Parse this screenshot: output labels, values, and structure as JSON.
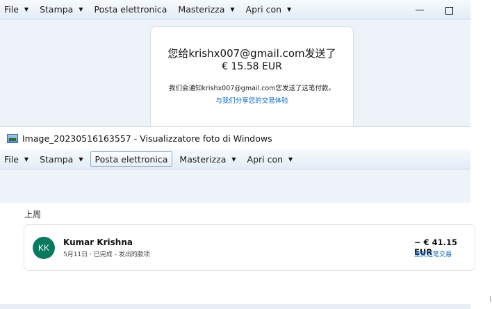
{
  "top_menu": {
    "items": [
      {
        "label": "File",
        "has_arrow": true
      },
      {
        "label": "Stampa",
        "has_arrow": true
      },
      {
        "label": "Posta elettronica",
        "has_arrow": false
      },
      {
        "label": "Masterizza",
        "has_arrow": true
      },
      {
        "label": "Apri con",
        "has_arrow": true
      }
    ]
  },
  "receipt": {
    "title": "您给krishx007@gmail.com发送了",
    "amount": "€ 15.58 EUR",
    "note": "我们会通知krishx007@gmail.com您发送了这笔付款。",
    "link": "与我们分享您的交易体验"
  },
  "window": {
    "title": "Image_20230516163557 - Visualizzatore foto di Windows",
    "minimize": "—"
  },
  "bottom_menu": {
    "items": [
      {
        "label": "File",
        "has_arrow": true
      },
      {
        "label": "Stampa",
        "has_arrow": true
      },
      {
        "label": "Posta elettronica",
        "has_arrow": false
      },
      {
        "label": "Masterizza",
        "has_arrow": true
      },
      {
        "label": "Apri con",
        "has_arrow": true
      }
    ]
  },
  "activity": {
    "section_label": "上周",
    "transaction": {
      "initials": "KK",
      "name": "Kumar Krishna",
      "meta": "5月11日 · 已完成 - 发出的款项",
      "amount": "− € 41.15 EUR",
      "repeat": "重复这笔交易"
    }
  },
  "colors": {
    "accent": "#0a66c2",
    "avatar_bg": "#0a7a5e",
    "menubar_bg": "#e3ecf6"
  }
}
